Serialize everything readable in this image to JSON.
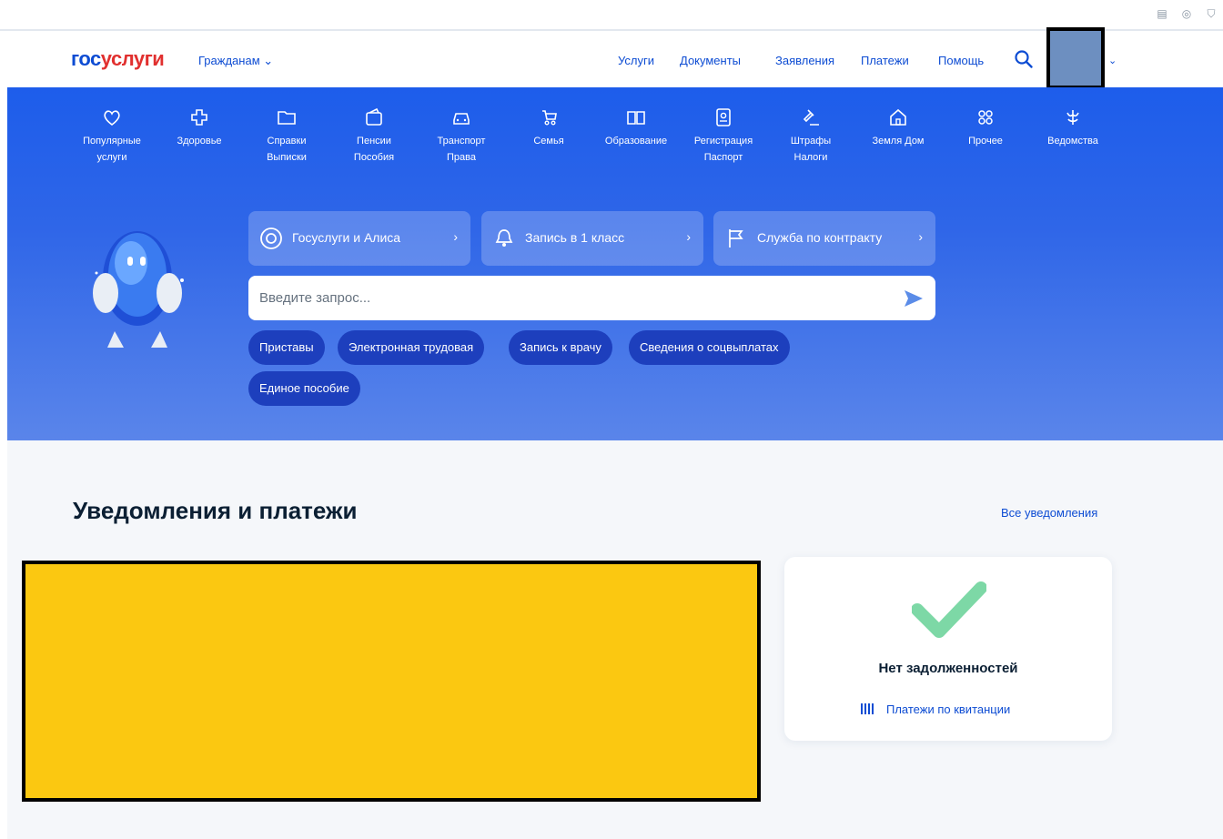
{
  "header": {
    "logo_part1": "гос",
    "logo_part2": "услуги",
    "audience": "Гражданам",
    "nav": [
      "Услуги",
      "Документы",
      "Заявления",
      "Платежи",
      "Помощь"
    ]
  },
  "categories": [
    {
      "icon": "heart-icon",
      "line1": "Популярные",
      "line2": "услуги"
    },
    {
      "icon": "cross-icon",
      "line1": "Здоровье",
      "line2": ""
    },
    {
      "icon": "folder-icon",
      "line1": "Справки",
      "line2": "Выписки"
    },
    {
      "icon": "wallet-icon",
      "line1": "Пенсии",
      "line2": "Пособия"
    },
    {
      "icon": "car-icon",
      "line1": "Транспорт",
      "line2": "Права"
    },
    {
      "icon": "stroller-icon",
      "line1": "Семья",
      "line2": ""
    },
    {
      "icon": "book-icon",
      "line1": "Образование",
      "line2": ""
    },
    {
      "icon": "passport-icon",
      "line1": "Регистрация",
      "line2": "Паспорт"
    },
    {
      "icon": "gavel-icon",
      "line1": "Штрафы",
      "line2": "Налоги"
    },
    {
      "icon": "house-icon",
      "line1": "Земля Дом",
      "line2": ""
    },
    {
      "icon": "grid-icon",
      "line1": "Прочее",
      "line2": ""
    },
    {
      "icon": "emblem-icon",
      "line1": "Ведомства",
      "line2": ""
    }
  ],
  "promos": [
    {
      "icon": "alice-icon",
      "label": "Госуслуги и Алиса"
    },
    {
      "icon": "school-bell-icon",
      "label": "Запись в 1 класс"
    },
    {
      "icon": "flag-icon",
      "label": "Служба по контракту"
    }
  ],
  "search": {
    "placeholder": "Введите запрос..."
  },
  "chips": [
    "Приставы",
    "Электронная трудовая",
    "Запись к врачу",
    "Сведения о соцвыплатах",
    "Единое пособие"
  ],
  "notifications": {
    "title": "Уведомления и платежи",
    "all_link": "Все уведомления",
    "no_debt": "Нет задолженностей",
    "receipts": "Платежи по квитанции"
  },
  "colors": {
    "brand_blue": "#0d4cd3",
    "brand_red": "#e1302f",
    "hero_blue": "#1d5deb",
    "success_green": "#6fd39b",
    "redaction_yellow": "#fbc811"
  }
}
